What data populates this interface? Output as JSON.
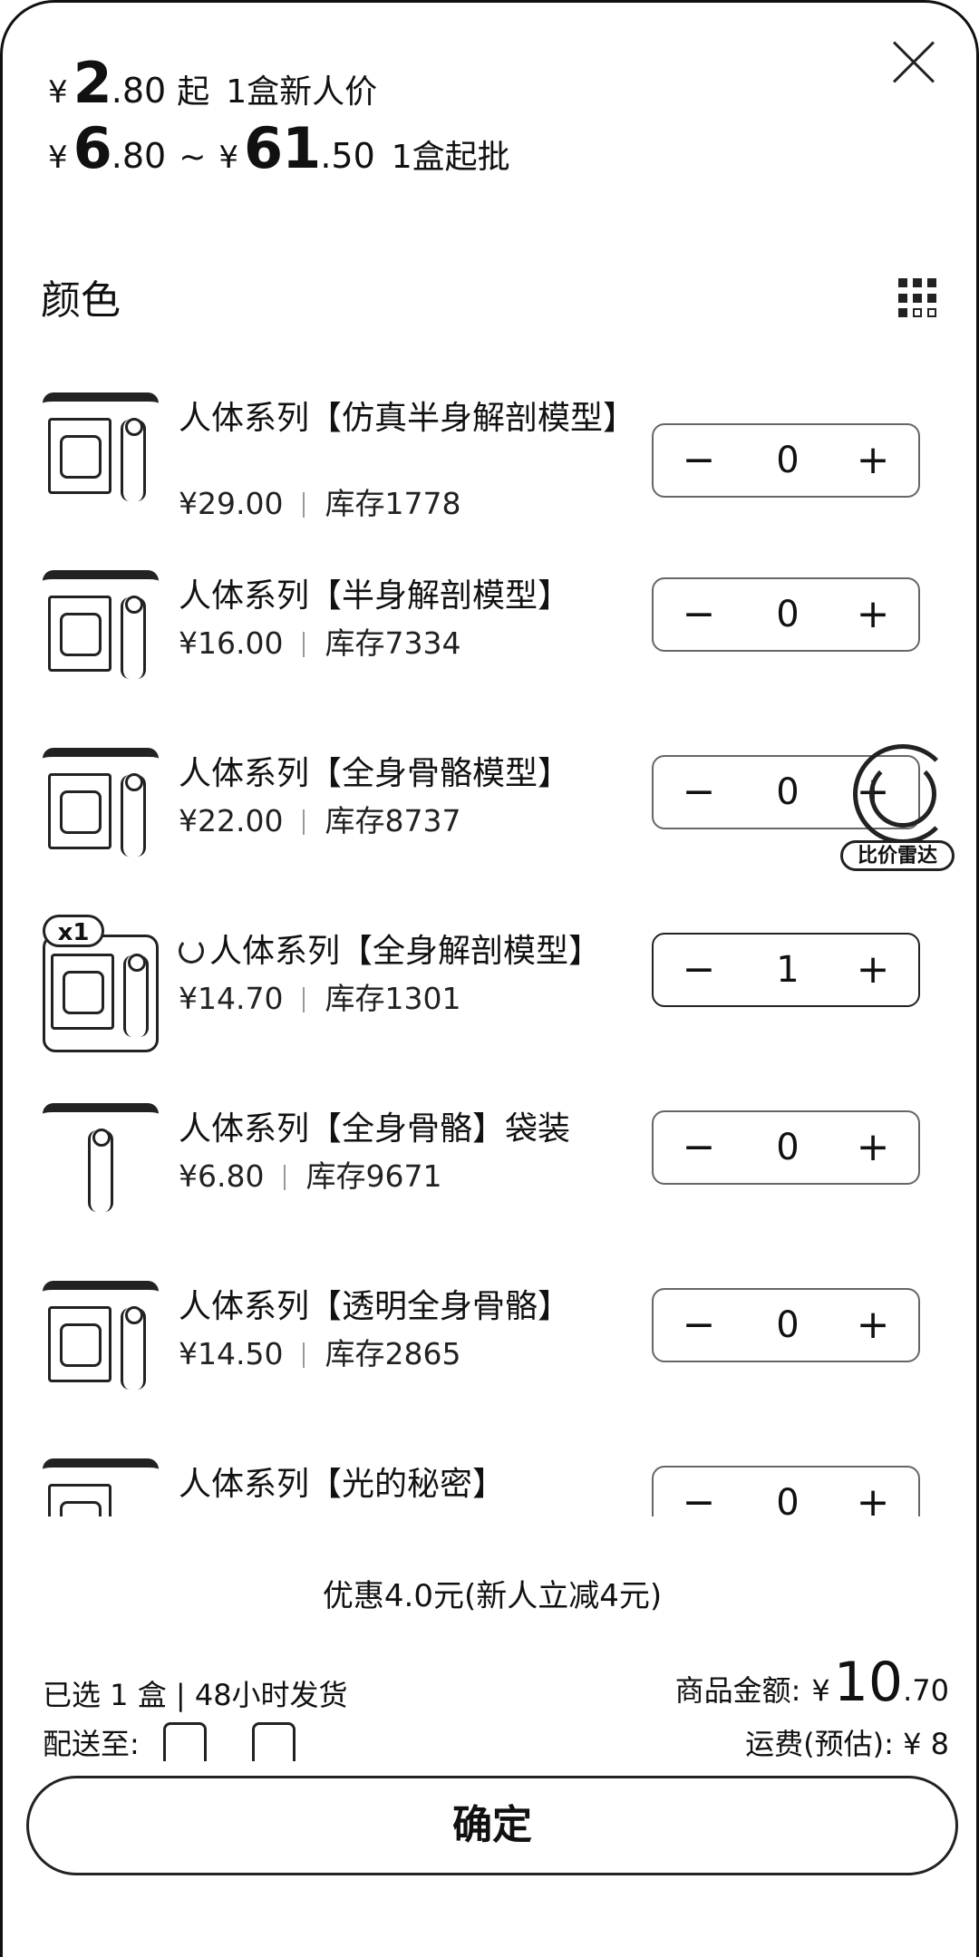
{
  "header": {
    "newcomer": {
      "currency": "¥",
      "int": "2",
      "dec": ".80",
      "suffix": "起",
      "note": "1盒新人价"
    },
    "range": {
      "currency": "¥",
      "min_int": "6",
      "min_dec": ".80",
      "tilde": "~",
      "max_int": "61",
      "max_dec": ".50",
      "note": "1盒起批"
    }
  },
  "section_title": "颜色",
  "items": [
    {
      "name": "人体系列【仿真半身解剖模型】",
      "price": "¥29.00",
      "stock": "库存1778",
      "qty": "0",
      "selected": false
    },
    {
      "name": "人体系列【半身解剖模型】",
      "price": "¥16.00",
      "stock": "库存7334",
      "qty": "0",
      "selected": false
    },
    {
      "name": "人体系列【全身骨骼模型】",
      "price": "¥22.00",
      "stock": "库存8737",
      "qty": "0",
      "selected": false
    },
    {
      "name": "人体系列【全身解剖模型】",
      "price": "¥14.70",
      "stock": "库存1301",
      "qty": "1",
      "selected": true,
      "badge": "x1"
    },
    {
      "name": "人体系列【全身骨骼】袋装",
      "price": "¥6.80",
      "stock": "库存9671",
      "qty": "0",
      "selected": false
    },
    {
      "name": "人体系列【透明全身骨骼】",
      "price": "¥14.50",
      "stock": "库存2865",
      "qty": "0",
      "selected": false
    },
    {
      "name": "人体系列【光的秘密】",
      "price": "",
      "stock": "",
      "qty": "0",
      "selected": false
    }
  ],
  "stepper": {
    "minus": "−",
    "plus": "+"
  },
  "float_badge": "比价雷达",
  "discount": "优惠4.0元(新人立减4元)",
  "footer": {
    "selected": "已选  1 盒 | 48小时发货",
    "ship_to_label": "配送至:",
    "amount_label": "商品金额:",
    "amount_currency": "¥",
    "amount_int": "10",
    "amount_dec": ".70",
    "freight": "运费(预估): ¥ 8"
  },
  "confirm_label": "确定"
}
